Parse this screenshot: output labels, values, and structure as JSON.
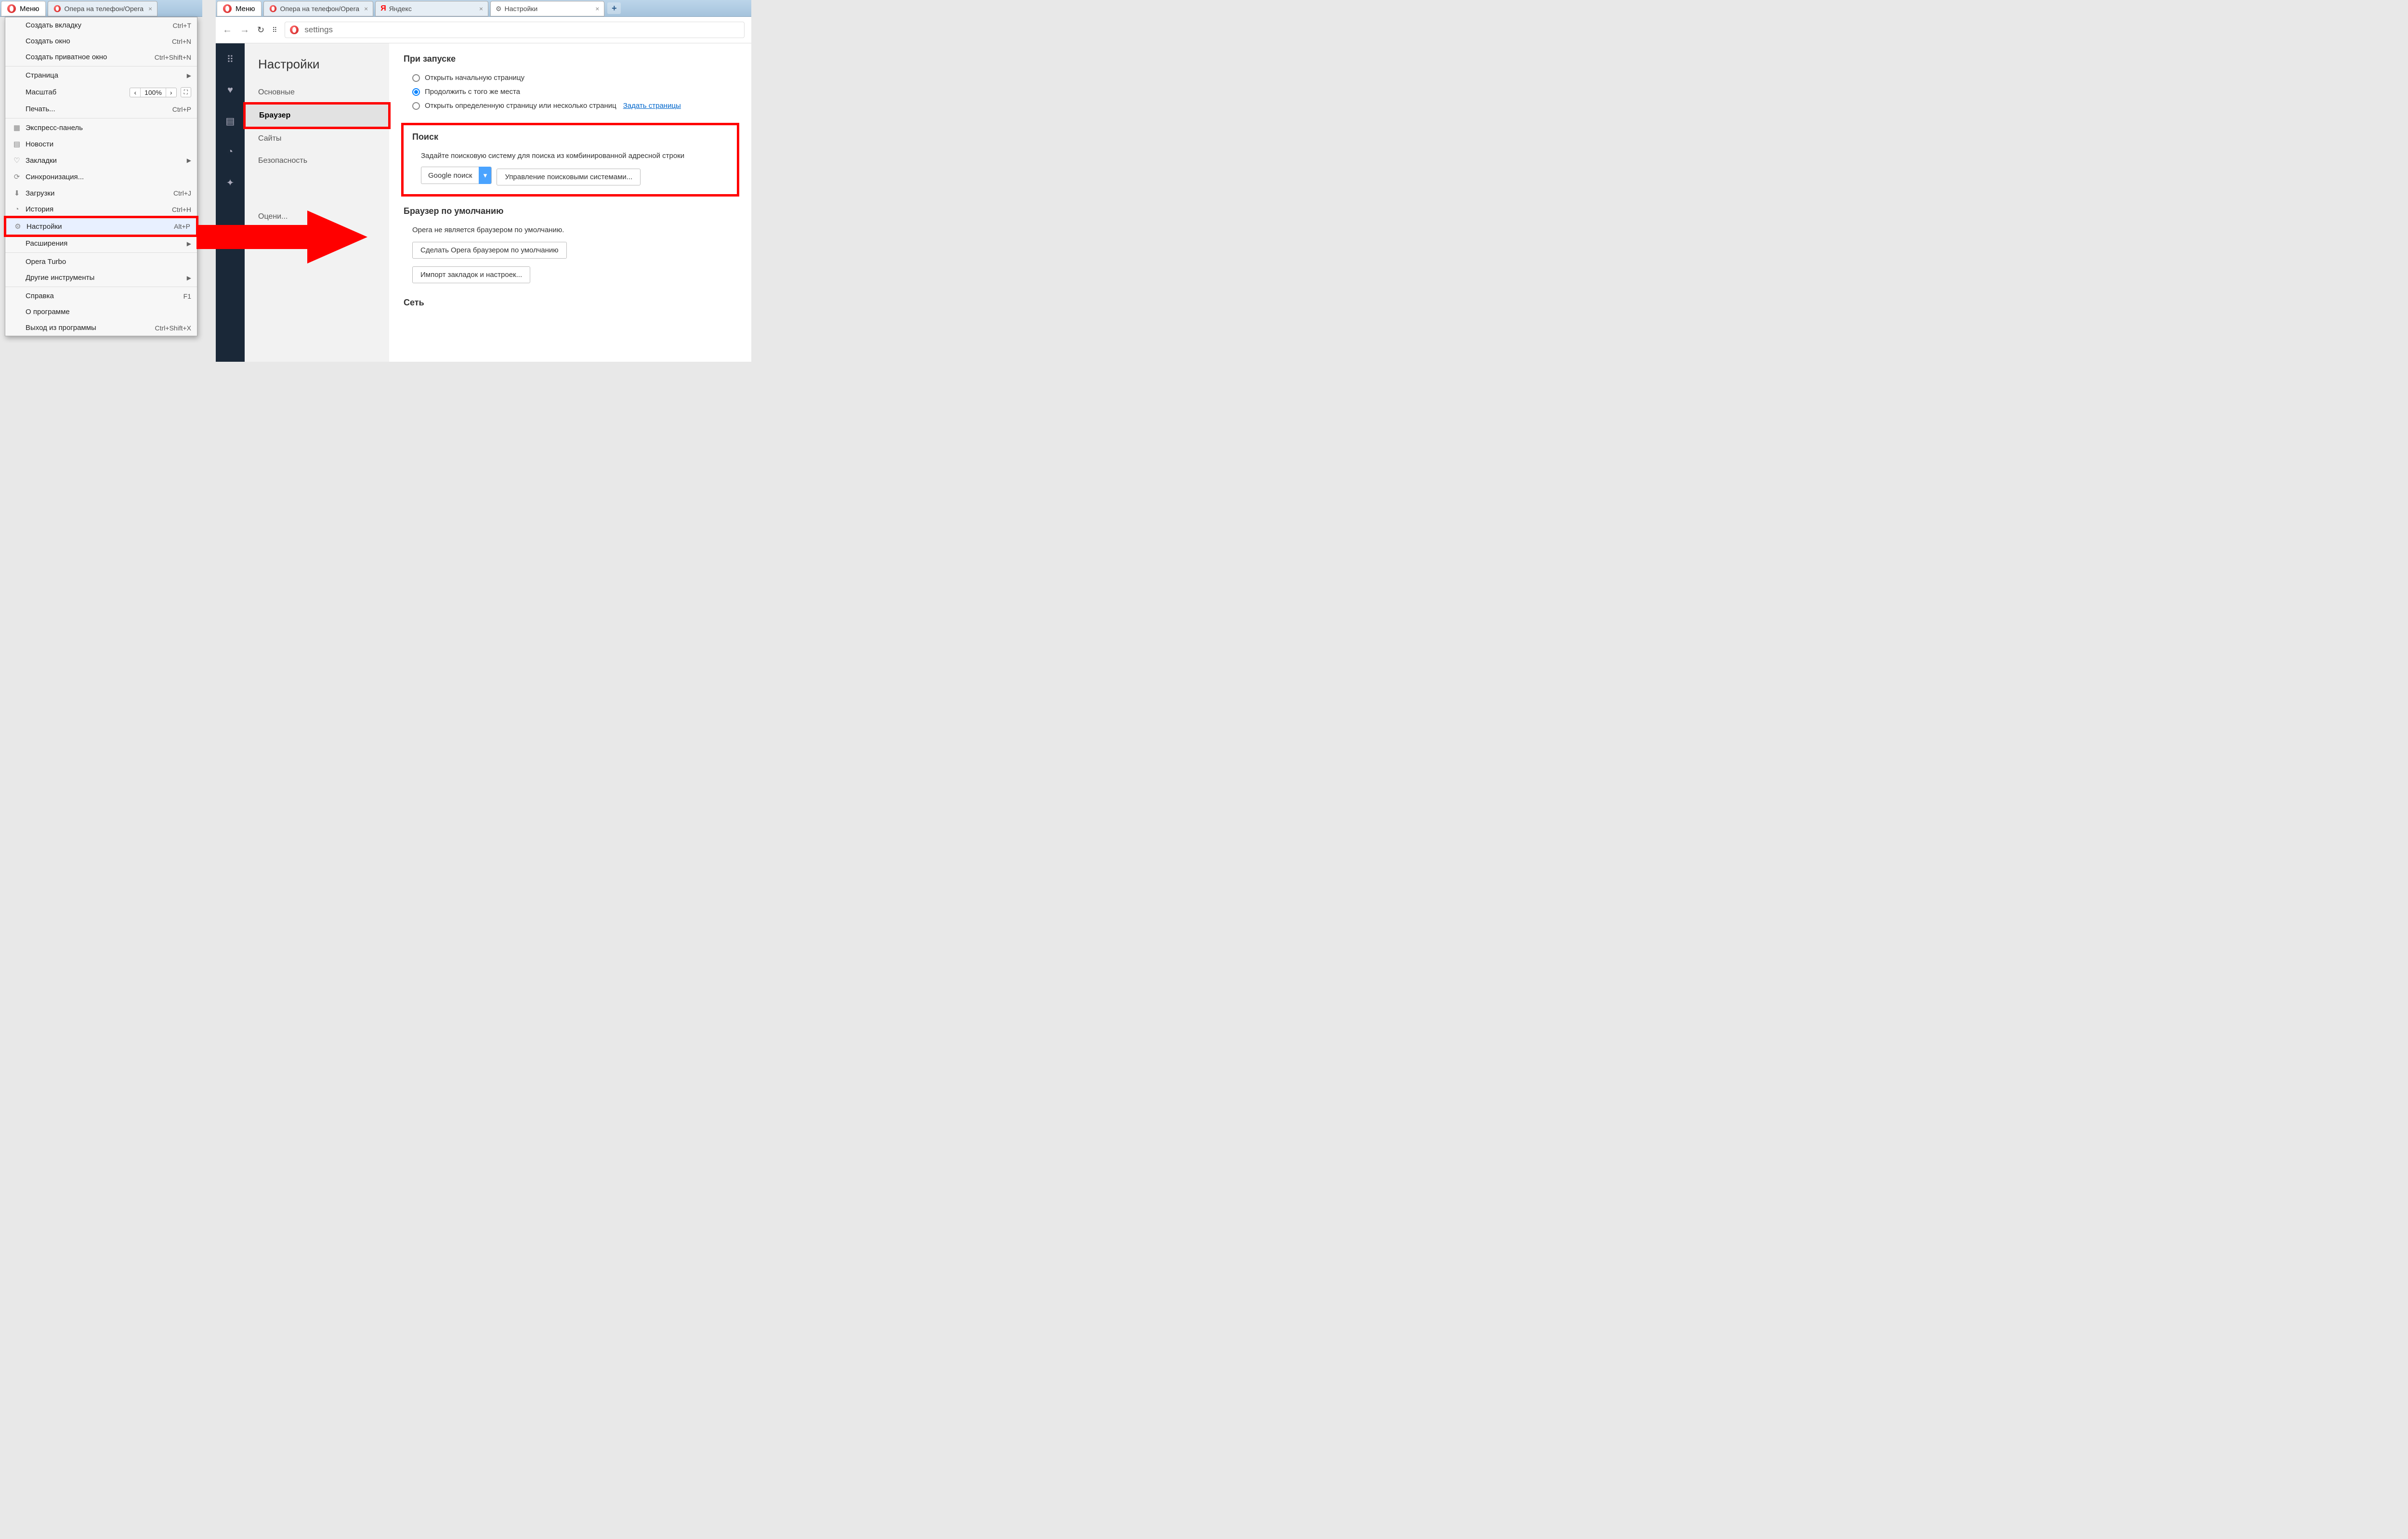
{
  "left": {
    "menu_label": "Меню",
    "tab1": "Опера на телефон/Opera",
    "menu_items": [
      {
        "label": "Создать вкладку",
        "shortcut": "Ctrl+T"
      },
      {
        "label": "Создать окно",
        "shortcut": "Ctrl+N"
      },
      {
        "label": "Создать приватное окно",
        "shortcut": "Ctrl+Shift+N"
      }
    ],
    "page": {
      "label": "Страница"
    },
    "zoom": {
      "label": "Масштаб",
      "value": "100%"
    },
    "print": {
      "label": "Печать...",
      "shortcut": "Ctrl+P"
    },
    "speed": {
      "label": "Экспресс-панель"
    },
    "news": {
      "label": "Новости"
    },
    "bookmarks": {
      "label": "Закладки"
    },
    "sync": {
      "label": "Синхронизация..."
    },
    "downloads": {
      "label": "Загрузки",
      "shortcut": "Ctrl+J"
    },
    "history": {
      "label": "История",
      "shortcut": "Ctrl+H"
    },
    "settings": {
      "label": "Настройки",
      "shortcut": "Alt+P"
    },
    "extensions": {
      "label": "Расширения"
    },
    "turbo": {
      "label": "Opera Turbo"
    },
    "tools": {
      "label": "Другие инструменты"
    },
    "help": {
      "label": "Справка",
      "shortcut": "F1"
    },
    "about": {
      "label": "О программе"
    },
    "exit": {
      "label": "Выход из программы",
      "shortcut": "Ctrl+Shift+X"
    }
  },
  "right": {
    "menu_label": "Меню",
    "tabs": [
      {
        "label": "Опера на телефон/Opera"
      },
      {
        "label": "Яндекс"
      },
      {
        "label": "Настройки"
      }
    ],
    "url": "settings",
    "sidebar_title": "Настройки",
    "sidebar": {
      "basic": "Основные",
      "browser": "Браузер",
      "sites": "Сайты",
      "security": "Безопасность",
      "rate": "Оцени..."
    },
    "startup": {
      "title": "При запуске",
      "opt1": "Открыть начальную страницу",
      "opt2": "Продолжить с того же места",
      "opt3": "Открыть определенную страницу или несколько страниц",
      "setpages": "Задать страницы"
    },
    "search": {
      "title": "Поиск",
      "desc": "Задайте поисковую систему для поиска из комбинированной адресной строки",
      "engine": "Google поиск",
      "manage": "Управление поисковыми системами..."
    },
    "default": {
      "title": "Браузер по умолчанию",
      "notdefault": "Opera не является браузером по умолчанию.",
      "make": "Сделать Opera браузером по умолчанию",
      "import": "Импорт закладок и настроек..."
    },
    "network": {
      "title": "Сеть"
    }
  }
}
